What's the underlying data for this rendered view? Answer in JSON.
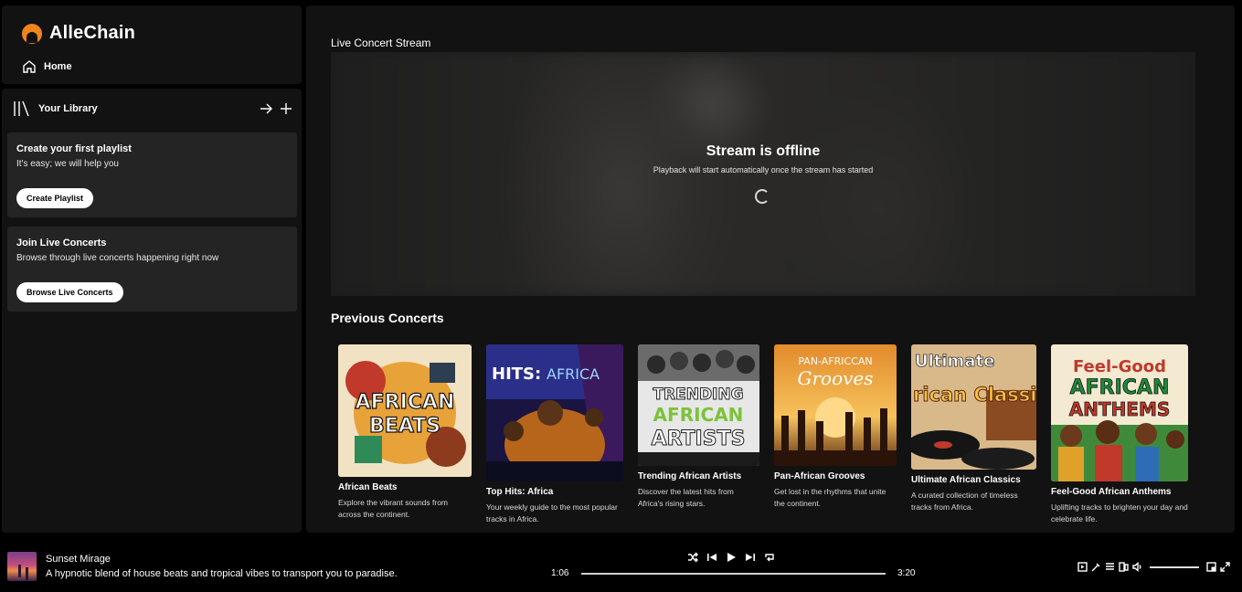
{
  "app": {
    "name": "AlleChain",
    "brand_color": "#f0851e"
  },
  "nav": {
    "home_label": "Home"
  },
  "library": {
    "title": "Your Library",
    "cards": [
      {
        "title": "Create your first playlist",
        "text": "It's easy; we will help you",
        "button": "Create Playlist"
      },
      {
        "title": "Join Live Concerts",
        "text": "Browse through live concerts happening right now",
        "button": "Browse Live Concerts"
      }
    ]
  },
  "live": {
    "section_label": "Live Concert Stream",
    "status_title": "Stream is offline",
    "status_sub": "Playback will start automatically once the stream has started"
  },
  "previous": {
    "title": "Previous Concerts",
    "items": [
      {
        "title": "African Beats",
        "desc": "Explore the vibrant sounds from across the continent.",
        "art_text": "AFRICAN BEATS"
      },
      {
        "title": "Top Hits: Africa",
        "desc": "Your weekly guide to the most popular tracks in Africa.",
        "art_text": "HITS: AFRICA"
      },
      {
        "title": "Trending African Artists",
        "desc": "Discover the latest hits from Africa's rising stars.",
        "art_text": "TRENDING AFRICAN ARTISTS"
      },
      {
        "title": "Pan-African Grooves",
        "desc": "Get lost in the rhythms that unite the continent.",
        "art_text": "PAN-AFRICCAN Grooves"
      },
      {
        "title": "Ultimate African Classics",
        "desc": "A curated collection of timeless tracks from Africa.",
        "art_text": "Ultimate African Classi"
      },
      {
        "title": "Feel-Good African Anthems",
        "desc": "Uplifting tracks to brighten your day and celebrate life.",
        "art_text": "Feel-Good AFRICAN ANTHEMS"
      }
    ]
  },
  "player": {
    "track_title": "Sunset Mirage",
    "track_desc": "A hypnotic blend of house beats and tropical vibes to transport you to paradise.",
    "current_time": "1:06",
    "total_time": "3:20",
    "progress": 0.0,
    "volume": 1.0
  }
}
